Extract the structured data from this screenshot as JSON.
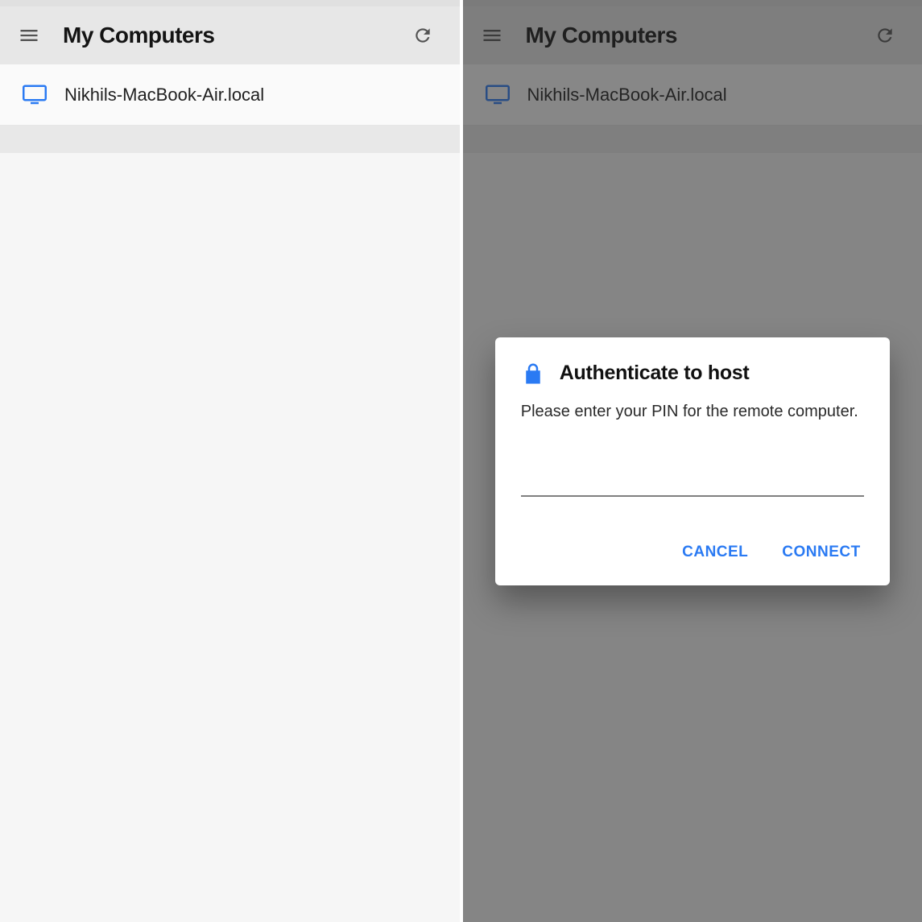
{
  "header": {
    "title": "My Computers"
  },
  "list": {
    "items": [
      {
        "name": "Nikhils-MacBook-Air.local"
      }
    ]
  },
  "dialog": {
    "title": "Authenticate to host",
    "message": "Please enter your PIN for the remote computer.",
    "pin_value": "",
    "cancel_label": "CANCEL",
    "connect_label": "CONNECT"
  },
  "colors": {
    "accent": "#2a7af3",
    "link_blue": "#2a7af3"
  }
}
